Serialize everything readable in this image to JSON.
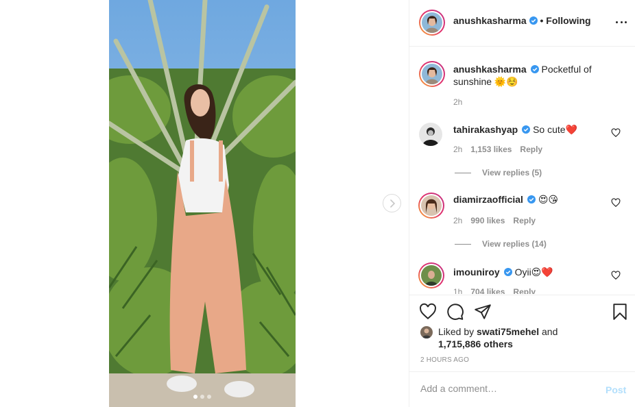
{
  "post": {
    "author": "anushkasharma",
    "follow_status": "• Following",
    "caption_username": "anushkasharma",
    "caption_text": "Pocketful of sunshine 🌞☺️",
    "caption_time": "2h",
    "carousel": {
      "slides": 3,
      "active_index": 0
    }
  },
  "comments": [
    {
      "username": "tahirakashyap",
      "text": "So cute❤️",
      "time": "2h",
      "likes": "1,153 likes",
      "reply": "Reply",
      "view_replies": "View replies (5)"
    },
    {
      "username": "diamirzaofficial",
      "text": "😍😘",
      "time": "2h",
      "likes": "990 likes",
      "reply": "Reply",
      "view_replies": "View replies (14)"
    },
    {
      "username": "imouniroy",
      "text": "Oyii😍❤️",
      "time": "1h",
      "likes": "704 likes",
      "reply": "Reply"
    }
  ],
  "likes": {
    "prefix": "Liked by",
    "user": "swati75mehel",
    "joiner": "and",
    "others": "1,715,886 others"
  },
  "time_ago": "2 HOURS AGO",
  "comment_box": {
    "placeholder": "Add a comment…",
    "post_label": "Post"
  },
  "colors": {
    "verified": "#3897f0",
    "post_disabled": "#b2dffc",
    "heart": "#ed4956"
  },
  "icons": [
    "more-options-icon",
    "verified-badge-icon",
    "heart-icon",
    "comment-icon",
    "share-icon",
    "bookmark-icon",
    "chevron-right-icon"
  ]
}
